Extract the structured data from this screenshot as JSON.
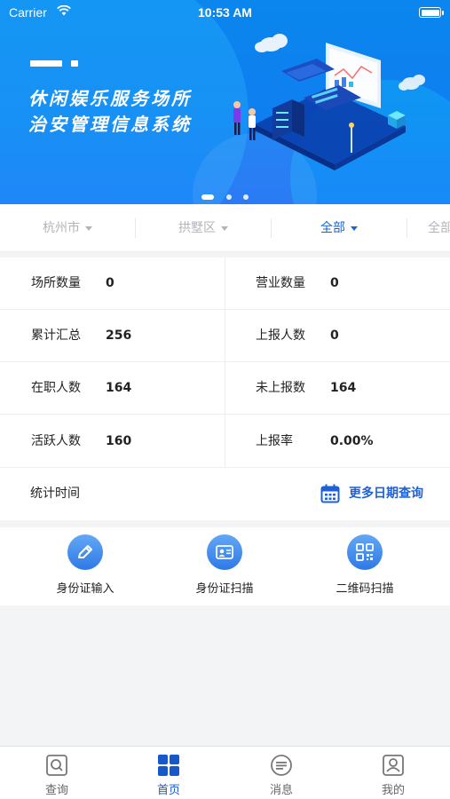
{
  "status_bar": {
    "carrier": "Carrier",
    "time": "10:53 AM",
    "battery_level": 1.0
  },
  "banner": {
    "title_line1": "休闲娱乐服务场所",
    "title_line2": "治安管理信息系统",
    "carousel_pages": 3,
    "active_page": 1
  },
  "filters": [
    {
      "label": "杭州市",
      "active": false
    },
    {
      "label": "拱墅区",
      "active": false
    },
    {
      "label": "全部",
      "active": true
    },
    {
      "label": "全部",
      "active": false
    }
  ],
  "stats": {
    "rows": [
      [
        {
          "label": "场所数量",
          "value": "0"
        },
        {
          "label": "营业数量",
          "value": "0"
        }
      ],
      [
        {
          "label": "累计汇总",
          "value": "256"
        },
        {
          "label": "上报人数",
          "value": "0"
        }
      ],
      [
        {
          "label": "在职人数",
          "value": "164"
        },
        {
          "label": "未上报数",
          "value": "164"
        }
      ],
      [
        {
          "label": "活跃人数",
          "value": "160"
        },
        {
          "label": "上报率",
          "value": "0.00%"
        }
      ]
    ],
    "time_label": "统计时间",
    "more_dates": "更多日期查询"
  },
  "actions": [
    {
      "label": "身份证输入",
      "icon": "pencil-icon"
    },
    {
      "label": "身份证扫描",
      "icon": "id-card-icon"
    },
    {
      "label": "二维码扫描",
      "icon": "qr-code-icon"
    }
  ],
  "tabs": [
    {
      "label": "查询",
      "icon": "search-icon",
      "active": false
    },
    {
      "label": "首页",
      "icon": "grid-icon",
      "active": true
    },
    {
      "label": "消息",
      "icon": "message-icon",
      "active": false
    },
    {
      "label": "我的",
      "icon": "profile-icon",
      "active": false
    }
  ],
  "colors": {
    "primary": "#1765d4",
    "banner": "#0f7ff0",
    "inactive": "#b0b4ba"
  }
}
